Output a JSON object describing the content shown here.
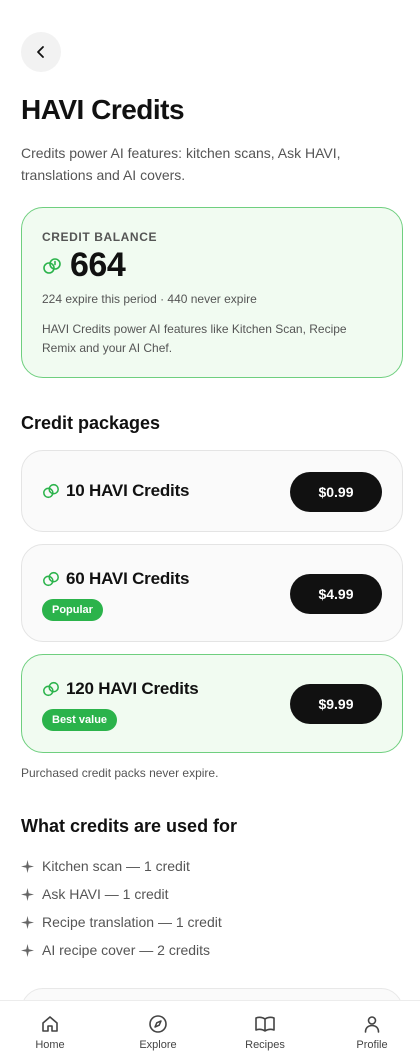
{
  "header": {
    "back_icon": "chevron-left-icon",
    "title": "HAVI Credits",
    "subtitle": "Credits power AI features: kitchen scans, Ask HAVI, translations and AI covers."
  },
  "balance": {
    "label": "CREDIT BALANCE",
    "icon": "credits-icon",
    "value": "664",
    "expire_text": "224 expire this period · 440 never expire",
    "description": "HAVI Credits power AI features like Kitchen Scan, Recipe Remix and your AI Chef."
  },
  "packages": {
    "section_title": "Credit packages",
    "items": [
      {
        "name": "10 HAVI Credits",
        "price": "$0.99",
        "badge": ""
      },
      {
        "name": "60 HAVI Credits",
        "price": "$4.99",
        "badge": "Popular"
      },
      {
        "name": "120 HAVI Credits",
        "price": "$9.99",
        "badge": "Best value"
      }
    ],
    "footnote": "Purchased credit packs never expire."
  },
  "uses": {
    "section_title": "What credits are used for",
    "items": [
      "Kitchen scan — 1 credit",
      "Ask HAVI — 1 credit",
      "Recipe translation — 1 credit",
      "AI recipe cover — 2 credits"
    ]
  },
  "tabs": [
    {
      "label": "Home",
      "icon": "home-icon"
    },
    {
      "label": "Explore",
      "icon": "compass-icon"
    },
    {
      "label": "Recipes",
      "icon": "book-icon"
    },
    {
      "label": "Profile",
      "icon": "user-icon"
    }
  ],
  "colors": {
    "accent_green": "#2bb34b",
    "card_border_green": "#6fcf7f",
    "card_bg_green": "#f1fbf1",
    "button_dark": "#111111"
  }
}
